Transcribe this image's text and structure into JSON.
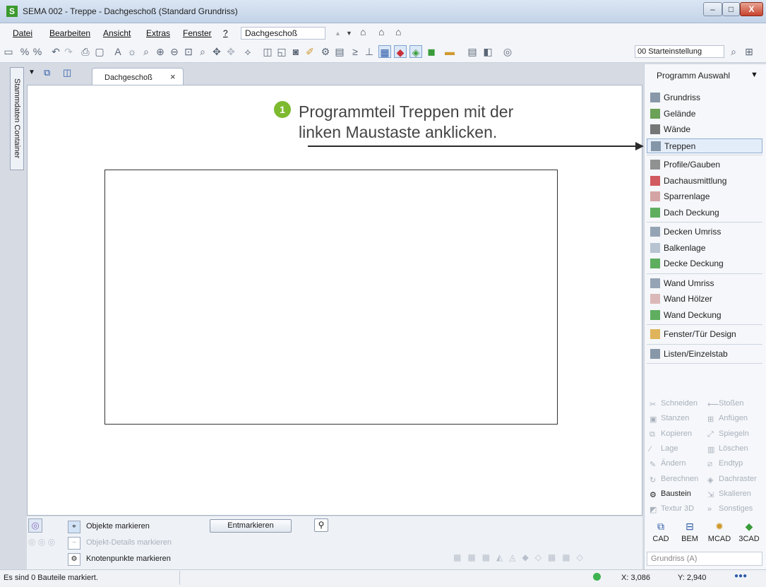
{
  "window": {
    "title": "SEMA  002 - Treppe  - Dachgeschoß (Standard Grundriss)",
    "logo": "S",
    "controls": [
      "–",
      "□",
      "X"
    ]
  },
  "menu": {
    "items": [
      "Datei",
      "Bearbeiten",
      "Ansicht",
      "Extras",
      "Fenster",
      "?"
    ],
    "level_value": "Dachgeschoß"
  },
  "toolbar": {
    "settings_value": "00 Starteinstellung"
  },
  "left_panel": {
    "tab_label": "Stammdaten Container"
  },
  "document": {
    "tab_label": "Dachgeschoß",
    "close": "×"
  },
  "callout": {
    "number": "1",
    "line1": "Programmteil Treppen mit der",
    "line2": "linken Maustaste anklicken."
  },
  "program_panel": {
    "header": "Programm Auswahl",
    "groups": [
      [
        {
          "label": "Grundriss",
          "icon": "floorplan-icon",
          "color": "#6d7f95"
        },
        {
          "label": "Gelände",
          "icon": "terrain-icon",
          "color": "#4a8b2f"
        },
        {
          "label": "Wände",
          "icon": "walls-icon",
          "color": "#555555"
        },
        {
          "label": "Treppen",
          "icon": "stairs-icon",
          "color": "#6d7f95",
          "selected": true
        }
      ],
      [
        {
          "label": "Profile/Gauben",
          "icon": "profile-icon",
          "color": "#777777"
        },
        {
          "label": "Dachausmittlung",
          "icon": "roof-calc-icon",
          "color": "#c8313a"
        },
        {
          "label": "Sparrenlage",
          "icon": "rafters-icon",
          "color": "#cc8e8e"
        },
        {
          "label": "Dach Deckung",
          "icon": "roof-cover-icon",
          "color": "#3a9b3a"
        }
      ],
      [
        {
          "label": "Decken Umriss",
          "icon": "ceiling-outline-icon",
          "color": "#7d8ea4"
        },
        {
          "label": "Balkenlage",
          "icon": "beams-icon",
          "color": "#a8b5c6"
        },
        {
          "label": "Decke Deckung",
          "icon": "ceiling-cover-icon",
          "color": "#3a9b3a"
        }
      ],
      [
        {
          "label": "Wand Umriss",
          "icon": "wall-outline-icon",
          "color": "#7d8ea4"
        },
        {
          "label": "Wand Hölzer",
          "icon": "wall-timber-icon",
          "color": "#d4a8a8"
        },
        {
          "label": "Wand Deckung",
          "icon": "wall-cover-icon",
          "color": "#3a9b3a"
        }
      ],
      [
        {
          "label": "Fenster/Tür Design",
          "icon": "window-door-icon",
          "color": "#d9a232"
        }
      ],
      [
        {
          "label": "Listen/Einzelstab",
          "icon": "lists-icon",
          "color": "#6d7f95"
        }
      ]
    ],
    "tools": [
      {
        "label": "Schneiden",
        "icon": "✂",
        "enabled": false
      },
      {
        "label": "Stoßen",
        "icon": "⟵",
        "enabled": false
      },
      {
        "label": "Stanzen",
        "icon": "▣",
        "enabled": false
      },
      {
        "label": "Anfügen",
        "icon": "⊞",
        "enabled": false
      },
      {
        "label": "Kopieren",
        "icon": "⧉",
        "enabled": false
      },
      {
        "label": "Spiegeln",
        "icon": "⤢",
        "enabled": false
      },
      {
        "label": "Lage",
        "icon": "⁄",
        "enabled": false
      },
      {
        "label": "Löschen",
        "icon": "▥",
        "enabled": false
      },
      {
        "label": "Ändern",
        "icon": "✎",
        "enabled": false
      },
      {
        "label": "Endtyp",
        "icon": "⧄",
        "enabled": false
      },
      {
        "label": "Berechnen",
        "icon": "↻",
        "enabled": false
      },
      {
        "label": "Dachraster",
        "icon": "◈",
        "enabled": false
      },
      {
        "label": "Baustein",
        "icon": "⚙",
        "enabled": true
      },
      {
        "label": "Skalieren",
        "icon": "⇲",
        "enabled": false
      },
      {
        "label": "Textur 3D",
        "icon": "◩",
        "enabled": false
      },
      {
        "label": "Sonstiges",
        "icon": "»",
        "enabled": false
      }
    ],
    "modules": [
      "CAD",
      "BEM",
      "MCAD",
      "3CAD"
    ],
    "view_select": "Grundriss (A)"
  },
  "marking": {
    "row1": "Objekte markieren",
    "row2": "Objekt-Details markieren",
    "row3": "Knotenpunkte markieren",
    "unmark_button": "Entmarkieren"
  },
  "status": {
    "message": "Es sind 0 Bauteile markiert.",
    "x": "X: 3,086",
    "y": "Y: 2,940"
  }
}
